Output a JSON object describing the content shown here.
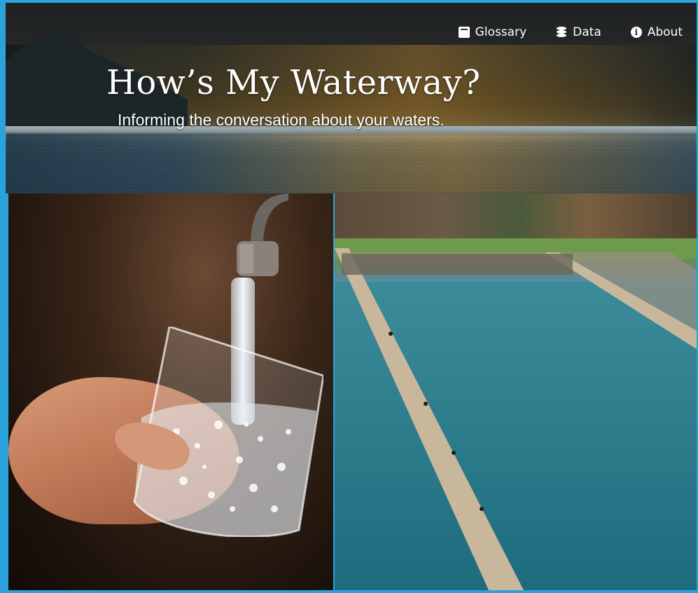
{
  "header": {
    "title": "How’s My Waterway?",
    "subtitle": "Informing the conversation about your waters.",
    "nav": [
      {
        "label": "Glossary",
        "icon": "book-icon"
      },
      {
        "label": "Data",
        "icon": "database-icon"
      },
      {
        "label": "About",
        "icon": "info-icon"
      }
    ]
  },
  "images": {
    "left": "tap-water-glass-photo",
    "right": "water-reservoir-photo"
  },
  "colors": {
    "page_background": "#2aa3dd",
    "text": "#ffffff"
  }
}
